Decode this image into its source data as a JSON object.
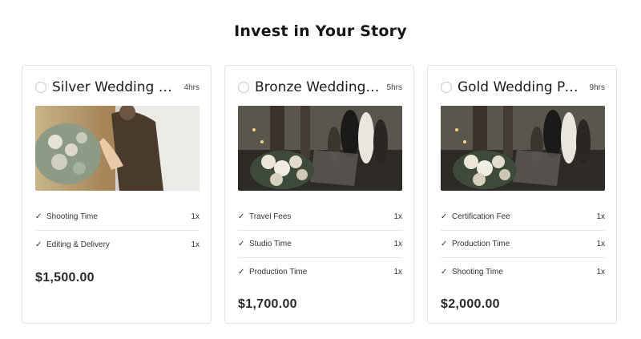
{
  "heading": "Invest in Your Story",
  "packages": [
    {
      "title": "Silver Wedding Pa...",
      "hours": "4hrs",
      "items": [
        {
          "label": "Shooting Time",
          "qty": "1x"
        },
        {
          "label": "Editing & Delivery",
          "qty": "1x"
        }
      ],
      "price": "$1,500.00"
    },
    {
      "title": "Bronze Wedding P...",
      "hours": "5hrs",
      "items": [
        {
          "label": "Travel Fees",
          "qty": "1x"
        },
        {
          "label": "Studio Time",
          "qty": "1x"
        },
        {
          "label": "Production Time",
          "qty": "1x"
        }
      ],
      "price": "$1,700.00"
    },
    {
      "title": "Gold Wedding Pac...",
      "hours": "9hrs",
      "items": [
        {
          "label": "Certification Fee",
          "qty": "1x"
        },
        {
          "label": "Production Time",
          "qty": "1x"
        },
        {
          "label": "Shooting Time",
          "qty": "1x"
        }
      ],
      "price": "$2,000.00"
    }
  ],
  "icons": {
    "check": "check-icon",
    "radio": "radio-icon"
  },
  "colors": {
    "text": "#222222",
    "border": "#e3e3e3",
    "divider": "#e8e8e8"
  }
}
